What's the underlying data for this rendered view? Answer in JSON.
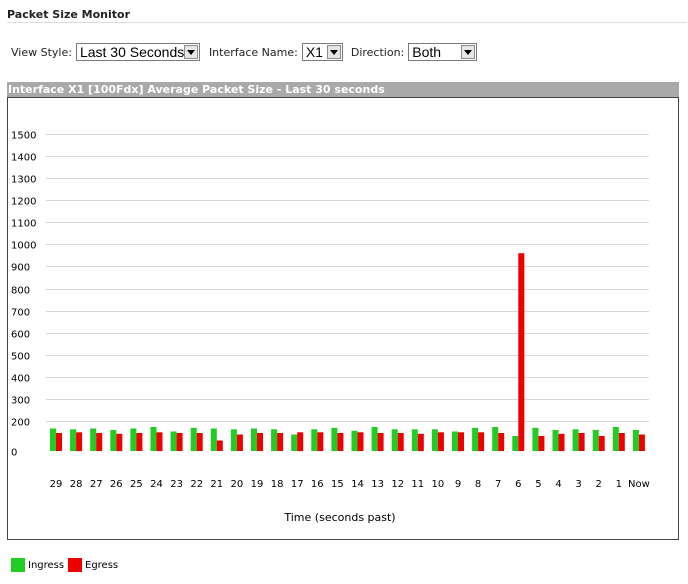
{
  "page": {
    "title": "Packet Size Monitor"
  },
  "controls": {
    "view_style": {
      "label": "View Style:",
      "value": "Last 30 Seconds"
    },
    "interface_name": {
      "label": "Interface Name:",
      "value": "X1"
    },
    "direction": {
      "label": "Direction:",
      "value": "Both"
    }
  },
  "chart_header": "Interface X1 [100Fdx] Average Packet Size - Last 30 seconds",
  "colors": {
    "ingress": "#22cc22",
    "egress": "#ee0000",
    "grid": "#d6d6d6",
    "header_bg": "#a9a9a9"
  },
  "chart_data": {
    "type": "bar",
    "title": "Interface X1 [100Fdx] Average Packet Size - Last 30 seconds",
    "xlabel": "Time (seconds past)",
    "ylabel": "",
    "ylim": [
      0,
      1500
    ],
    "yticks": [
      0,
      200,
      300,
      400,
      500,
      600,
      700,
      800,
      900,
      1000,
      1100,
      1200,
      1300,
      1400,
      1500
    ],
    "grid": true,
    "legend_position": "bottom-left",
    "categories": [
      "29",
      "28",
      "27",
      "26",
      "25",
      "24",
      "23",
      "22",
      "21",
      "20",
      "19",
      "18",
      "17",
      "16",
      "15",
      "14",
      "13",
      "12",
      "11",
      "10",
      "9",
      "8",
      "7",
      "6",
      "5",
      "4",
      "3",
      "2",
      "1",
      "Now"
    ],
    "series": [
      {
        "name": "Ingress",
        "values": [
          150,
          145,
          150,
          140,
          150,
          160,
          130,
          155,
          150,
          145,
          150,
          145,
          110,
          145,
          155,
          135,
          160,
          145,
          145,
          145,
          130,
          155,
          160,
          100,
          155,
          140,
          145,
          140,
          160,
          140
        ]
      },
      {
        "name": "Egress",
        "values": [
          120,
          125,
          120,
          115,
          120,
          125,
          120,
          120,
          70,
          110,
          120,
          120,
          125,
          125,
          120,
          125,
          120,
          120,
          115,
          125,
          125,
          125,
          120,
          960,
          100,
          115,
          120,
          100,
          120,
          110
        ]
      }
    ]
  }
}
